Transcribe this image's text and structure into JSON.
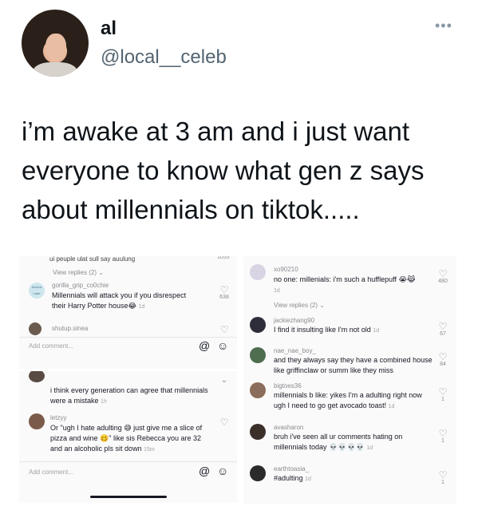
{
  "tweet": {
    "name": "al",
    "handle": "@local__celeb",
    "text": "i’m awake at 3 am and i just want everyone to know what gen z says about millennials on tiktok.....",
    "more_icon": "more-horizontal-icon"
  },
  "left_top": {
    "cut_text": "ui peuple ulat sull say auulung",
    "cut_count": "1055",
    "view_replies": "View replies (2)",
    "comments": [
      {
        "user": "gorilla_grip_co0chie",
        "avatar_text": "Mocha Latte",
        "text": "Millennials will attack you if you disrespect their Harry Potter house😂",
        "time": "1d",
        "likes": "638"
      },
      {
        "user": "shutup.sinea",
        "text": "",
        "time": "",
        "likes": ""
      }
    ],
    "add_comment": "Add comment..."
  },
  "left_bottom": {
    "comments": [
      {
        "user": "",
        "text": "i think every generation can agree that millennials were a mistake",
        "time": "1h",
        "likes": ""
      },
      {
        "user": "letzyy",
        "text": "Or \"ugh I hate adulting 😅 just give me a slice of pizza and wine 🥴\" like sis Rebecca you are 32 and an alcoholic pls sit down",
        "time": "15m",
        "likes": ""
      }
    ],
    "add_comment": "Add comment..."
  },
  "right": {
    "comments": [
      {
        "user": "xo90210",
        "text": "no one: millenials: i'm such a hufflepuff 😭😹",
        "time": "1d",
        "likes": "480"
      },
      {
        "user": "jackiezhang90",
        "text": "I find it insulting like I'm not old",
        "time": "1d",
        "likes": "67"
      },
      {
        "user": "nae_nae_boy_",
        "text": "and they always say they have a combined house like griffinclaw or summ like they miss",
        "time": "",
        "likes": "84"
      },
      {
        "user": "bigtoes36",
        "text": "millennials b like: yikes I'm a  adulting right now ugh I need to go get avocado toast!",
        "time": "1d",
        "likes": "1"
      },
      {
        "user": "avasharon",
        "text": "bruh i've seen all ur comments hating on millennials today 💀💀💀💀",
        "time": "1d",
        "likes": "1"
      },
      {
        "user": "earthtoasia_",
        "text": "#adulting",
        "time": "1d",
        "likes": "1"
      }
    ],
    "view_replies": "View replies (2)"
  }
}
